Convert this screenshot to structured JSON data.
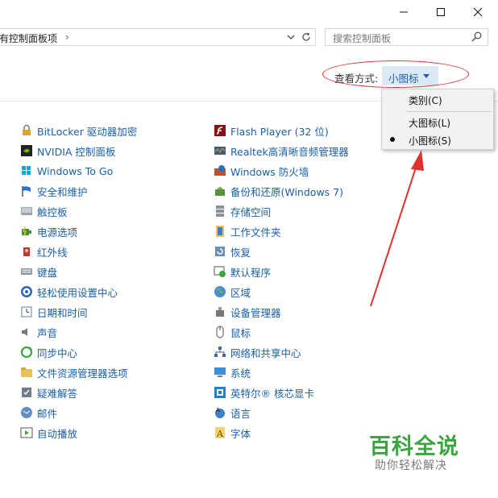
{
  "window": {
    "icons": [
      "minimize-icon",
      "maximize-icon",
      "close-icon"
    ]
  },
  "address_bar": {
    "path": "有控制面板项",
    "chevron": "›"
  },
  "search": {
    "placeholder": "搜索控制面板"
  },
  "view_by": {
    "label": "查看方式:",
    "value": "小图标"
  },
  "view_menu": {
    "items": [
      {
        "label": "类别(C)",
        "selected": false
      },
      {
        "label": "大图标(L)",
        "selected": false
      },
      {
        "label": "小图标(S)",
        "selected": true
      }
    ]
  },
  "items_left": [
    {
      "label": "BitLocker 驱动器加密",
      "icon": "bitlocker-icon"
    },
    {
      "label": "NVIDIA 控制面板",
      "icon": "nvidia-icon"
    },
    {
      "label": "Windows To Go",
      "icon": "windows-to-go-icon"
    },
    {
      "label": "安全和维护",
      "icon": "flag-icon"
    },
    {
      "label": "触控板",
      "icon": "touchpad-icon"
    },
    {
      "label": "电源选项",
      "icon": "power-icon"
    },
    {
      "label": "红外线",
      "icon": "infrared-icon"
    },
    {
      "label": "键盘",
      "icon": "keyboard-icon"
    },
    {
      "label": "轻松使用设置中心",
      "icon": "ease-of-access-icon"
    },
    {
      "label": "日期和时间",
      "icon": "clock-icon"
    },
    {
      "label": "声音",
      "icon": "speaker-icon"
    },
    {
      "label": "同步中心",
      "icon": "sync-icon"
    },
    {
      "label": "文件资源管理器选项",
      "icon": "folder-options-icon"
    },
    {
      "label": "疑难解答",
      "icon": "troubleshoot-icon"
    },
    {
      "label": "邮件",
      "icon": "mail-icon"
    },
    {
      "label": "自动播放",
      "icon": "autoplay-icon"
    }
  ],
  "items_right": [
    {
      "label": "Flash Player (32 位)",
      "icon": "flash-icon"
    },
    {
      "label": "Realtek高清晰音频管理器",
      "icon": "realtek-audio-icon"
    },
    {
      "label": "Windows 防火墙",
      "icon": "firewall-icon"
    },
    {
      "label": "备份和还原(Windows 7)",
      "icon": "backup-icon"
    },
    {
      "label": "存储空间",
      "icon": "storage-icon"
    },
    {
      "label": "工作文件夹",
      "icon": "work-folders-icon"
    },
    {
      "label": "恢复",
      "icon": "recovery-icon"
    },
    {
      "label": "默认程序",
      "icon": "default-programs-icon"
    },
    {
      "label": "区域",
      "icon": "region-icon"
    },
    {
      "label": "设备管理器",
      "icon": "device-manager-icon"
    },
    {
      "label": "鼠标",
      "icon": "mouse-icon"
    },
    {
      "label": "网络和共享中心",
      "icon": "network-icon"
    },
    {
      "label": "系统",
      "icon": "system-icon"
    },
    {
      "label": "英特尔® 核芯显卡",
      "icon": "intel-graphics-icon"
    },
    {
      "label": "语言",
      "icon": "language-icon"
    },
    {
      "label": "字体",
      "icon": "font-icon"
    }
  ],
  "watermark": {
    "title": "百科全说",
    "subtitle": "助你轻松解决"
  },
  "colors": {
    "link": "#1a5fa5",
    "annotation": "#e0312e",
    "watermark": "#3aa63d"
  }
}
